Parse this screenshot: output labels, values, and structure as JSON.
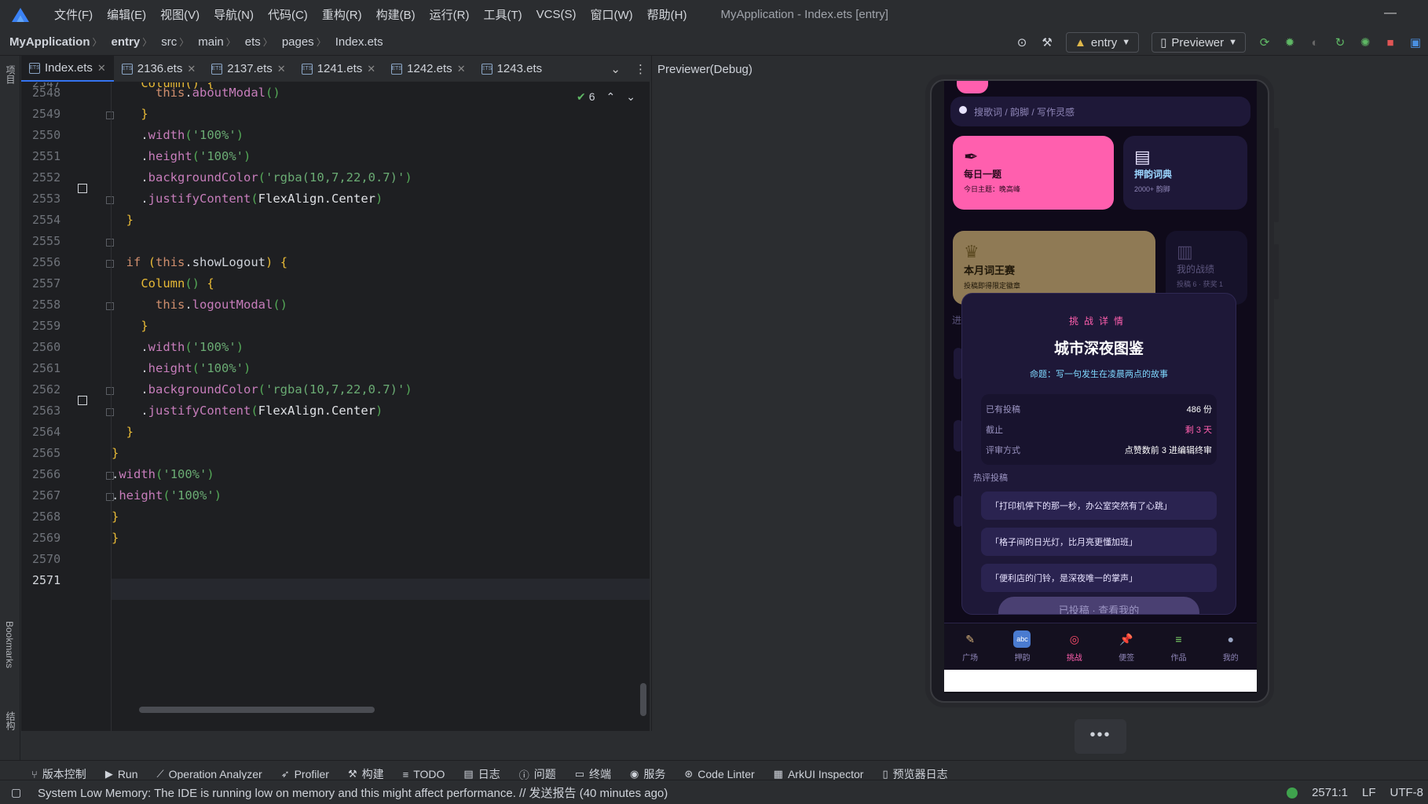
{
  "menubar": {
    "items": [
      "文件(F)",
      "编辑(E)",
      "视图(V)",
      "导航(N)",
      "代码(C)",
      "重构(R)",
      "构建(B)",
      "运行(R)",
      "工具(T)",
      "VCS(S)",
      "窗口(W)",
      "帮助(H)"
    ],
    "window_title": "MyApplication - Index.ets [entry]",
    "minimize": "—"
  },
  "breadcrumb": {
    "items": [
      "MyApplication",
      "entry",
      "src",
      "main",
      "ets",
      "pages",
      "Index.ets"
    ],
    "run_config": "entry",
    "device": "Previewer"
  },
  "left_stripe": {
    "project": "项目",
    "bookmarks": "Bookmarks",
    "structure": "结构"
  },
  "tabs": [
    {
      "label": "Index.ets",
      "active": true
    },
    {
      "label": "2136.ets"
    },
    {
      "label": "2137.ets"
    },
    {
      "label": "1241.ets"
    },
    {
      "label": "1242.ets"
    },
    {
      "label": "1243.ets"
    }
  ],
  "inspections": {
    "ok_count": "6"
  },
  "code": {
    "first_line_partial": "Column() {",
    "line_numbers": [
      "2548",
      "2549",
      "2550",
      "2551",
      "2552",
      "2553",
      "2554",
      "2555",
      "2556",
      "2557",
      "2558",
      "2559",
      "2560",
      "2561",
      "2562",
      "2563",
      "2564",
      "2565",
      "2566",
      "2567",
      "2568",
      "2569",
      "2570",
      "2571"
    ],
    "current_line": "2571"
  },
  "previewer": {
    "title": "Previewer(Debug)",
    "more": "•••"
  },
  "app": {
    "search_placeholder": "搜歌词 / 韵脚 / 写作灵感",
    "card_daily_title": "每日一题",
    "card_daily_sub": "今日主题：晚高峰",
    "card_rhyme_title": "押韵词典",
    "card_rhyme_sub": "2000+ 韵脚",
    "card_contest_title": "本月词王赛",
    "card_contest_sub": "投稿即得限定徽章",
    "card_record_title": "我的战绩",
    "card_record_sub": "投稿 6 · 获奖 1",
    "section_stub": "进",
    "modal": {
      "kicker": "挑战详情",
      "title": "城市深夜图鉴",
      "theme": "命题：写一句发生在凌晨两点的故事",
      "rows": [
        {
          "label": "已有投稿",
          "value": "486 份"
        },
        {
          "label": "截止",
          "value": "剩 3 天"
        },
        {
          "label": "评审方式",
          "value": "点赞数前 3 进编辑终审"
        }
      ],
      "hot_title": "热评投稿",
      "quotes": [
        "「打印机停下的那一秒，办公室突然有了心跳」",
        "「格子间的日光灯，比月亮更懂加班」",
        "「便利店的门铃，是深夜唯一的掌声」"
      ],
      "button": "已投稿 · 查看我的"
    },
    "tabbar": [
      {
        "label": "广场",
        "icon": "✎"
      },
      {
        "label": "押韵",
        "icon": "abc"
      },
      {
        "label": "挑战",
        "icon": "◎"
      },
      {
        "label": "便签",
        "icon": "📌"
      },
      {
        "label": "作品",
        "icon": "≡"
      },
      {
        "label": "我的",
        "icon": "●"
      }
    ]
  },
  "bottom_tools": [
    "版本控制",
    "Run",
    "Operation Analyzer",
    "Profiler",
    "构建",
    "TODO",
    "日志",
    "问题",
    "终端",
    "服务",
    "Code Linter",
    "ArkUI Inspector",
    "预览器日志"
  ],
  "status": {
    "message": "System Low Memory: The IDE is running low on memory and this might affect performance. // 发送报告 (40 minutes ago)",
    "position": "2571:1",
    "line_sep": "LF",
    "encoding": "UTF-8"
  }
}
